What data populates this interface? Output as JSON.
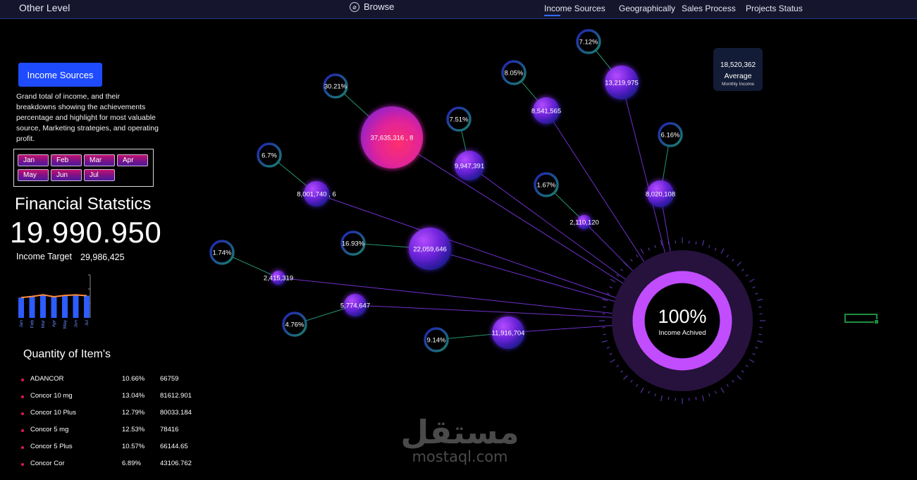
{
  "topbar": {
    "left_title": "Other Level",
    "browse_label": "Browse",
    "nav": [
      "Income Sources",
      "Geographically",
      "Sales Process",
      "Projects Status"
    ]
  },
  "left_panel": {
    "button_label": "Income Sources",
    "description": "Grand total of income, and their breakdowns showing the achievements percentage and highlight for most valuable source, Marketing strategies, and operating profit.",
    "months": [
      "Jan",
      "Feb",
      "Mar",
      "Apr",
      "May",
      "Jun",
      "Jul"
    ],
    "fin_title": "Financial Statstics",
    "fin_value": "19.990.950",
    "target_label": "Income Target",
    "target_value": "29,986,425"
  },
  "mini_chart": {
    "categories": [
      "Jan",
      "Feb",
      "Mar",
      "Apr",
      "May",
      "Jun",
      "Jul"
    ],
    "bars": [
      0.76,
      0.8,
      0.86,
      0.79,
      0.84,
      0.86,
      0.83
    ],
    "line": [
      0.76,
      0.8,
      0.86,
      0.79,
      0.84,
      0.86,
      0.83
    ]
  },
  "quantity": {
    "title": "Quantity of Item's",
    "items": [
      {
        "name": "ADANCOR",
        "pct": "10.66%",
        "value": "66759"
      },
      {
        "name": "Concor 10 mg",
        "pct": "13.04%",
        "value": "81612.901"
      },
      {
        "name": "Concor 10 Plus",
        "pct": "12.79%",
        "value": "80033.184"
      },
      {
        "name": "Concor 5 mg",
        "pct": "12.53%",
        "value": "78416"
      },
      {
        "name": "Concor 5 Plus",
        "pct": "10.57%",
        "value": "66144.65"
      },
      {
        "name": "Concor Cor",
        "pct": "6.89%",
        "value": "43106.762"
      }
    ]
  },
  "average_card": {
    "number": "18,520,362",
    "label": "Average",
    "sub": "Monthly Income"
  },
  "gauge": {
    "value": "100%",
    "label": "Income Achived",
    "fraction": 1.0
  },
  "bubbles": [
    {
      "value": "37,635,316 , 8",
      "pct": "30.21%"
    },
    {
      "value": "13,219,975",
      "pct": "7.12%"
    },
    {
      "value": "8,541,565",
      "pct": "8.05%"
    },
    {
      "value": "9,947,391",
      "pct": "7.51%"
    },
    {
      "value": "8,020,108",
      "pct": "6.16%"
    },
    {
      "value": "8,001,740 , 6",
      "pct": "6.7%"
    },
    {
      "value": "2,110,120",
      "pct": "1.67%"
    },
    {
      "value": "22,059,646",
      "pct": "16.93%"
    },
    {
      "value": "2,415,319",
      "pct": "1.74%"
    },
    {
      "value": "5,774,647",
      "pct": "4.76%"
    },
    {
      "value": "11,916,704",
      "pct": "9.14%"
    }
  ],
  "colors": {
    "accent_blue": "#1f4bff",
    "bubble_purple": "#7a2cf0",
    "bubble_pink": "#ff2a6d",
    "gauge_ring": "#c04bff"
  },
  "watermark": {
    "arabic": "مستقل",
    "latin": "mostaql.com"
  }
}
